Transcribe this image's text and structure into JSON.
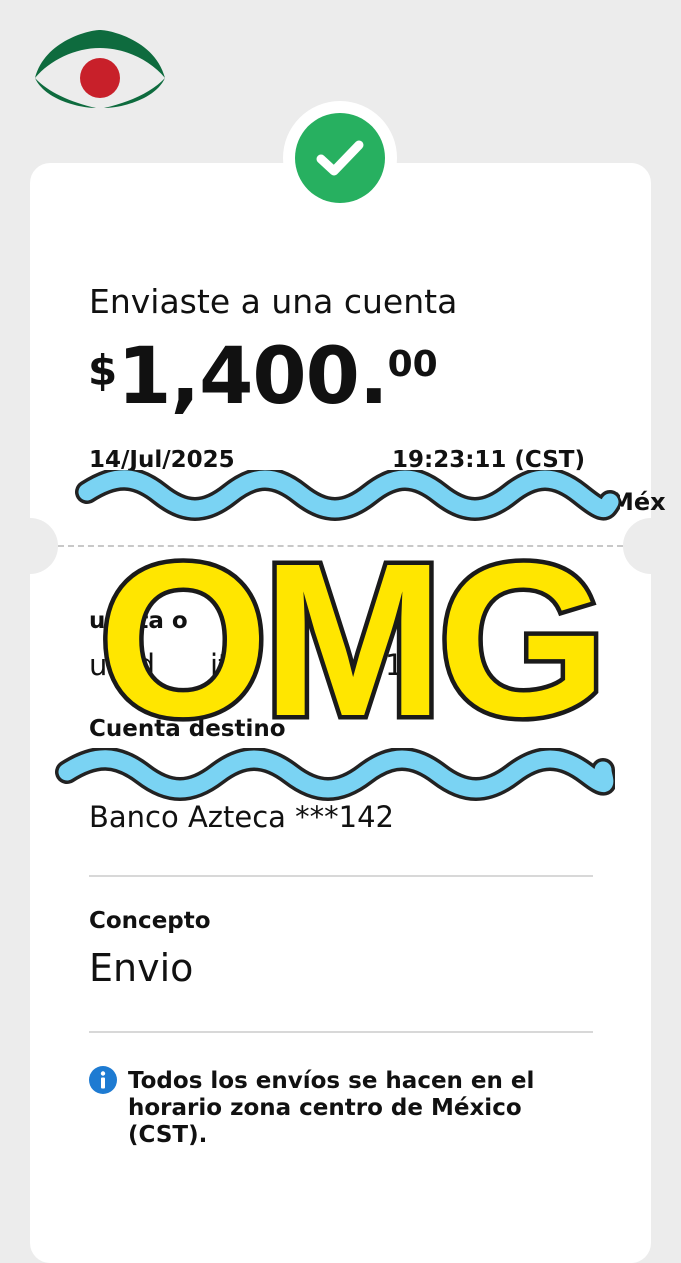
{
  "logo": {
    "name": "bank-logo",
    "colors": {
      "green": "#0e6b3e",
      "red": "#c8202a"
    }
  },
  "receipt": {
    "status_icon": "checkmark-icon",
    "title": "Enviaste a una cuenta",
    "amount": {
      "currency": "$",
      "integer": "1,400.",
      "decimals": "00"
    },
    "date": "14/Jul/2025",
    "time": "19:23:11 (CST)",
    "partially_visible_line_fragment": "Méx",
    "origin_label_fragment": "uenta o",
    "origin_value_fragment": "uard",
    "origin_value_fragment2": "itor",
    "origin_value_fragment3": "*",
    "origin_value_fragment4": "1",
    "destination_label": "Cuenta destino",
    "destination_bank": "Banco Azteca ***142",
    "concept_label": "Concepto",
    "concept_value": "Envio",
    "info_icon": "info-icon",
    "info_text": "Todos los envíos se hacen en el horario zona centro de México (CST)."
  },
  "overlay": {
    "sticker_text": "OMG",
    "sticker_fill": "#ffe600",
    "squiggle_color": "#7ad3f3"
  },
  "colors": {
    "success": "#27b060",
    "info": "#1e7bd2"
  }
}
